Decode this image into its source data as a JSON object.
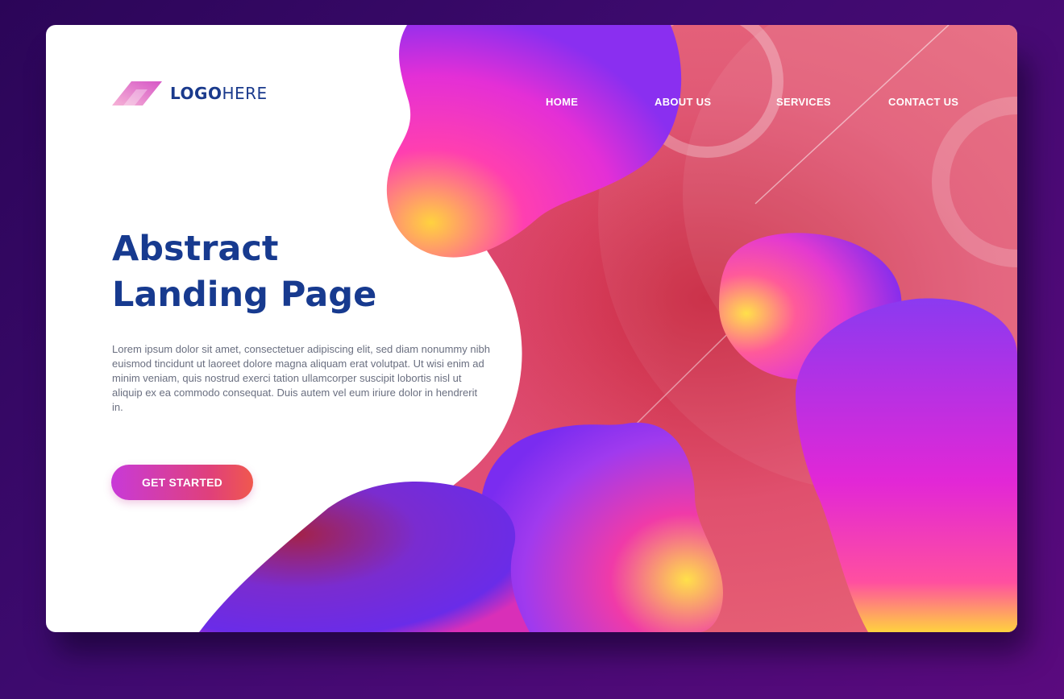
{
  "brand": {
    "logo_bold": "LOGO",
    "logo_light": "HERE",
    "logo_color": "#1a3a8c"
  },
  "nav": {
    "items": [
      {
        "label": "HOME"
      },
      {
        "label": "ABOUT US"
      },
      {
        "label": "SERVICES"
      },
      {
        "label": "CONTACT US"
      }
    ]
  },
  "hero": {
    "title_line1": "Abstract",
    "title_line2": "Landing Page",
    "body": "Lorem ipsum dolor sit amet, consectetuer adipiscing elit, sed diam nonummy nibh euismod tincidunt ut laoreet dolore magna aliquam erat volutpat. Ut wisi enim ad minim veniam, quis nostrud exerci tation ullamcorper suscipit lobortis nisl ut aliquip ex ea commodo consequat. Duis autem vel eum iriure dolor in hendrerit in.",
    "cta_label": "GET STARTED"
  },
  "colors": {
    "page_background": "#3d0a6e",
    "title": "#173a8f",
    "accent_pink": "#e0407a",
    "accent_magenta": "#c83ad8",
    "accent_violet": "#7a2cf0",
    "accent_yellow": "#ffd23f"
  }
}
